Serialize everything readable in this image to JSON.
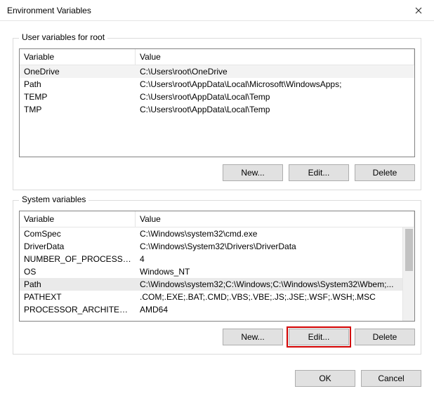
{
  "window": {
    "title": "Environment Variables"
  },
  "user_section": {
    "legend": "User variables for root",
    "columns": {
      "variable": "Variable",
      "value": "Value"
    },
    "rows": [
      {
        "name": "OneDrive",
        "value": "C:\\Users\\root\\OneDrive"
      },
      {
        "name": "Path",
        "value": "C:\\Users\\root\\AppData\\Local\\Microsoft\\WindowsApps;"
      },
      {
        "name": "TEMP",
        "value": "C:\\Users\\root\\AppData\\Local\\Temp"
      },
      {
        "name": "TMP",
        "value": "C:\\Users\\root\\AppData\\Local\\Temp"
      }
    ],
    "buttons": {
      "new": "New...",
      "edit": "Edit...",
      "delete": "Delete"
    }
  },
  "system_section": {
    "legend": "System variables",
    "columns": {
      "variable": "Variable",
      "value": "Value"
    },
    "rows": [
      {
        "name": "ComSpec",
        "value": "C:\\Windows\\system32\\cmd.exe"
      },
      {
        "name": "DriverData",
        "value": "C:\\Windows\\System32\\Drivers\\DriverData"
      },
      {
        "name": "NUMBER_OF_PROCESSORS",
        "value": "4"
      },
      {
        "name": "OS",
        "value": "Windows_NT"
      },
      {
        "name": "Path",
        "value": "C:\\Windows\\system32;C:\\Windows;C:\\Windows\\System32\\Wbem;..."
      },
      {
        "name": "PATHEXT",
        "value": ".COM;.EXE;.BAT;.CMD;.VBS;.VBE;.JS;.JSE;.WSF;.WSH;.MSC"
      },
      {
        "name": "PROCESSOR_ARCHITECTURE",
        "value": "AMD64"
      }
    ],
    "buttons": {
      "new": "New...",
      "edit": "Edit...",
      "delete": "Delete"
    }
  },
  "dialog_buttons": {
    "ok": "OK",
    "cancel": "Cancel"
  }
}
